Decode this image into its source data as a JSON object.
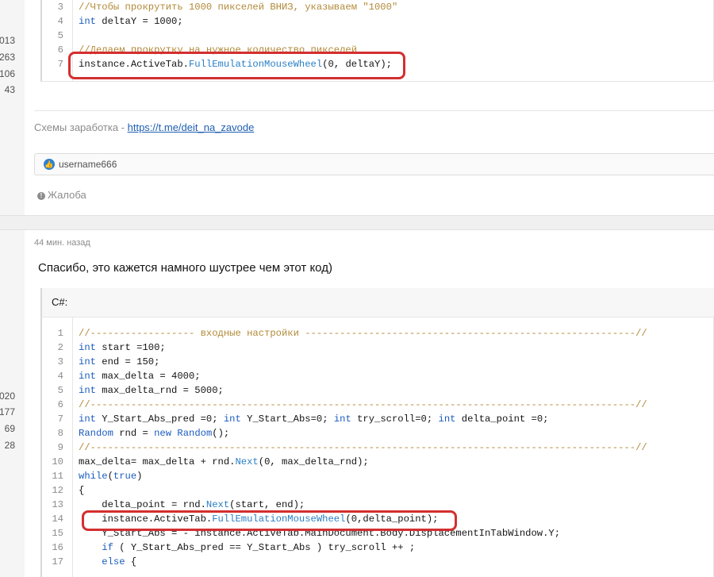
{
  "user_stats_top": [
    "013",
    "263",
    "106",
    "43"
  ],
  "user_stats_bottom": [
    "020",
    "177",
    "69",
    "28"
  ],
  "top_code": {
    "lines": [
      {
        "n": "3",
        "parts": [
          [
            "com",
            "//Чтобы прокрутить 1000 пикселей ВНИЗ, указываем \"1000\""
          ]
        ]
      },
      {
        "n": "4",
        "parts": [
          [
            "kw",
            "int"
          ],
          [
            "txt",
            " deltaY = 1000;"
          ]
        ]
      },
      {
        "n": "5",
        "parts": []
      },
      {
        "n": "6",
        "parts": [
          [
            "com",
            "//Делаем прокрутку на нужное количество пикселей"
          ]
        ]
      },
      {
        "n": "7",
        "parts": [
          [
            "txt",
            "instance.ActiveTab."
          ],
          [
            "fn",
            "FullEmulationMouseWheel"
          ],
          [
            "txt",
            "(0, deltaY);"
          ]
        ]
      }
    ]
  },
  "signature": {
    "prefix": "Схемы заработка - ",
    "link": "https://t.me/deit_na_zavode"
  },
  "reactions": {
    "user": "username666"
  },
  "report_label": "Жалоба",
  "post": {
    "time": "44 мин. назад",
    "text": "Спасибо, это кажется намного шустрее чем этот код)",
    "code_lang": "C#:"
  },
  "bottom_code": {
    "lines": [
      {
        "n": "1",
        "parts": [
          [
            "com",
            "//------------------ входные настройки ---------------------------------------------------------//"
          ]
        ]
      },
      {
        "n": "2",
        "parts": [
          [
            "kw",
            "int"
          ],
          [
            "txt",
            " start =100;"
          ]
        ]
      },
      {
        "n": "3",
        "parts": [
          [
            "kw",
            "int"
          ],
          [
            "txt",
            " end = 150;"
          ]
        ]
      },
      {
        "n": "4",
        "parts": [
          [
            "kw",
            "int"
          ],
          [
            "txt",
            " max_delta = 4000;"
          ]
        ]
      },
      {
        "n": "5",
        "parts": [
          [
            "kw",
            "int"
          ],
          [
            "txt",
            " max_delta_rnd = 5000;"
          ]
        ]
      },
      {
        "n": "6",
        "parts": [
          [
            "com",
            "//----------------------------------------------------------------------------------------------//"
          ]
        ]
      },
      {
        "n": "7",
        "parts": [
          [
            "kw",
            "int"
          ],
          [
            "txt",
            " Y_Start_Abs_pred =0; "
          ],
          [
            "kw",
            "int"
          ],
          [
            "txt",
            " Y_Start_Abs=0; "
          ],
          [
            "kw",
            "int"
          ],
          [
            "txt",
            " try_scroll=0; "
          ],
          [
            "kw",
            "int"
          ],
          [
            "txt",
            " delta_point =0;"
          ]
        ]
      },
      {
        "n": "8",
        "parts": [
          [
            "kw",
            "Random"
          ],
          [
            "txt",
            " rnd = "
          ],
          [
            "kw",
            "new"
          ],
          [
            "txt",
            " "
          ],
          [
            "kw",
            "Random"
          ],
          [
            "txt",
            "();"
          ]
        ]
      },
      {
        "n": "9",
        "parts": [
          [
            "com",
            "//----------------------------------------------------------------------------------------------//"
          ]
        ]
      },
      {
        "n": "10",
        "parts": [
          [
            "txt",
            "max_delta= max_delta + rnd."
          ],
          [
            "fn",
            "Next"
          ],
          [
            "txt",
            "(0, max_delta_rnd);"
          ]
        ]
      },
      {
        "n": "11",
        "parts": [
          [
            "kw",
            "while"
          ],
          [
            "txt",
            "("
          ],
          [
            "kw",
            "true"
          ],
          [
            "txt",
            ")"
          ]
        ]
      },
      {
        "n": "12",
        "parts": [
          [
            "txt",
            "{"
          ]
        ]
      },
      {
        "n": "13",
        "parts": [
          [
            "txt",
            "    delta_point = rnd."
          ],
          [
            "fn",
            "Next"
          ],
          [
            "txt",
            "(start, end);"
          ]
        ]
      },
      {
        "n": "14",
        "parts": [
          [
            "txt",
            "    instance.ActiveTab."
          ],
          [
            "fn",
            "FullEmulationMouseWheel"
          ],
          [
            "txt",
            "(0,delta_point);"
          ]
        ]
      },
      {
        "n": "15",
        "parts": [
          [
            "txt",
            "    Y_Start_Abs = - instance.ActiveTab.MainDocument.Body.DisplacementInTabWindow.Y;"
          ]
        ]
      },
      {
        "n": "16",
        "parts": [
          [
            "txt",
            "    "
          ],
          [
            "kw",
            "if"
          ],
          [
            "txt",
            " ( Y_Start_Abs_pred == Y_Start_Abs ) try_scroll ++ ;"
          ]
        ]
      },
      {
        "n": "17",
        "parts": [
          [
            "txt",
            "    "
          ],
          [
            "kw",
            "else"
          ],
          [
            "txt",
            " {"
          ]
        ]
      }
    ]
  }
}
